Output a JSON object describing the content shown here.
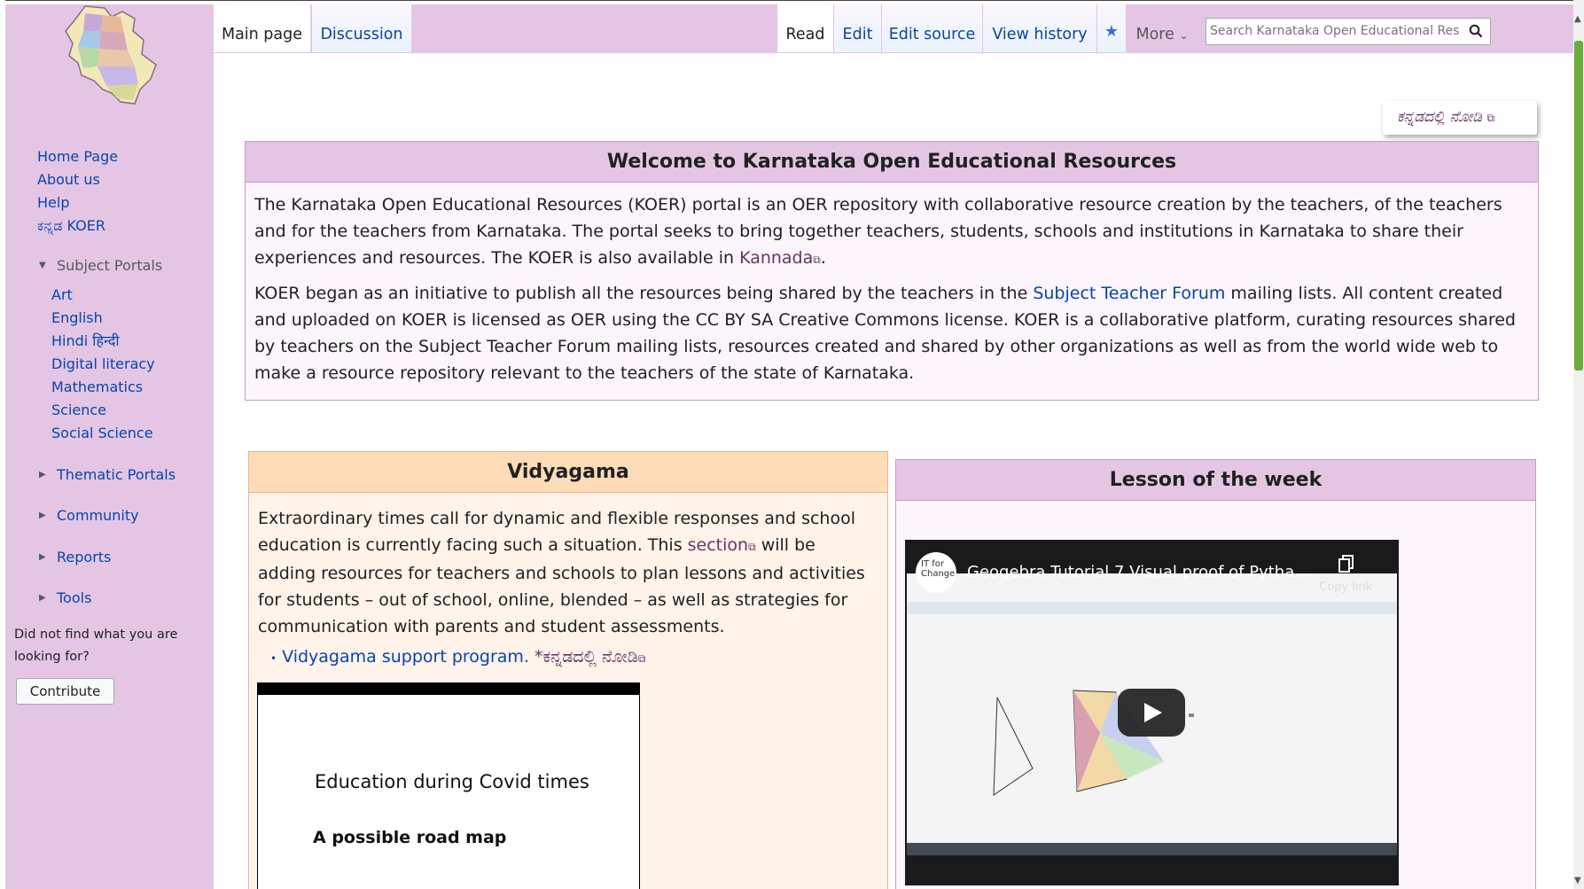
{
  "tabs": {
    "main_page": "Main page",
    "discussion": "Discussion",
    "read": "Read",
    "edit": "Edit",
    "edit_source": "Edit source",
    "view_history": "View history",
    "more": "More"
  },
  "search": {
    "placeholder": "Search Karnataka Open Educational Resources"
  },
  "sidebar": {
    "nav": [
      "Home Page",
      "About us",
      "Help",
      "ಕನ್ನಡ KOER"
    ],
    "subject_portals_label": "Subject Portals",
    "subject_portals": [
      "Art",
      "English",
      "Hindi हिन्दी",
      "Digital literacy",
      "Mathematics",
      "Science",
      "Social Science"
    ],
    "collapsed": [
      "Thematic Portals",
      "Community",
      "Reports",
      "Tools"
    ],
    "not_found": "Did not find what you are looking for?",
    "contribute": "Contribute"
  },
  "kannada_link": "ಕನ್ನಡದಲ್ಲಿ ನೋಡಿ",
  "welcome": {
    "title": "Welcome to Karnataka Open Educational Resources",
    "p1_text": "The Karnataka Open Educational Resources (KOER) portal is an OER repository with collaborative resource creation by the teachers, of the teachers and for the teachers from Karnataka. The portal seeks to bring together teachers, students, schools and institutions in Karnataka to share their experiences and resources. The KOER is also available in ",
    "p1_link": "Kannada",
    "p2_a": "KOER began as an initiative to publish all the resources being shared by the teachers in the ",
    "p2_link": "Subject Teacher Forum",
    "p2_b": " mailing lists. All content created and uploaded on KOER is licensed as OER using the CC BY SA Creative Commons license. KOER is a collaborative platform, curating resources shared by teachers on the Subject Teacher Forum mailing lists, resources created and shared by other organizations as well as from the world wide web to make a resource repository relevant to the teachers of the state of Karnataka."
  },
  "vidyagama": {
    "title": "Vidyagama",
    "p_a": "Extraordinary times call for dynamic and flexible responses and school education is currently facing such a situation. This ",
    "p_link": "section",
    "p_b": " will be adding resources for teachers and schools to plan lessons and activities for students – out of school, online, blended – as well as strategies for communication with parents and student assessments.",
    "bullet_link": "Vidyagama support program.",
    "bullet_kannada": "*ಕನ್ನಡದಲ್ಲಿ ನೋಡಿ",
    "card_title": "Education during Covid times",
    "card_sub": "A possible road map"
  },
  "lesson": {
    "title": "Lesson of the week",
    "video_title": "Geogebra Tutorial 7 Visual proof of Pytha...",
    "copy_link": "Copy link",
    "channel": "IT for Change"
  },
  "colors": {
    "sidebar": "#e4c6e4",
    "link": "#0645ad",
    "vidyagama_header": "#ffdcb8"
  }
}
